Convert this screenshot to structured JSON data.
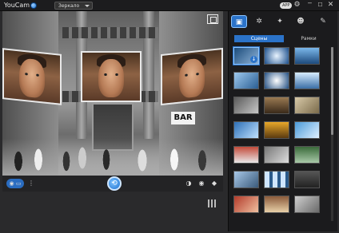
{
  "titlebar": {
    "app_title": "YouCam",
    "device": "Зеркало",
    "badge": "APP",
    "icons": [
      "status-dot-icon",
      "gear-icon",
      "minimize-icon",
      "maximize-icon",
      "close-icon"
    ]
  },
  "preview": {
    "sign_text": "BAR",
    "icons": [
      "fullscreen-icon"
    ]
  },
  "bottom_bar": {
    "icons": [
      "camera-mode-icon",
      "more-options-icon",
      "capture-icon",
      "brightness-icon",
      "eye-icon",
      "eraser-icon",
      "grid-icon"
    ]
  },
  "panel": {
    "tabs": [
      {
        "icon": "scenes-icon",
        "active": true
      },
      {
        "icon": "effects-icon",
        "active": false
      },
      {
        "icon": "magic-wand-icon",
        "active": false
      },
      {
        "icon": "avatar-icon",
        "active": false
      },
      {
        "icon": "brush-icon",
        "active": false
      }
    ],
    "subtabs": [
      {
        "label": "Сцены",
        "active": true
      },
      {
        "label": "Рамки",
        "active": false
      }
    ],
    "thumb_count": 21,
    "colors": {
      "accent": "#2b73c9",
      "panel_bg": "#1b1b1d"
    }
  }
}
